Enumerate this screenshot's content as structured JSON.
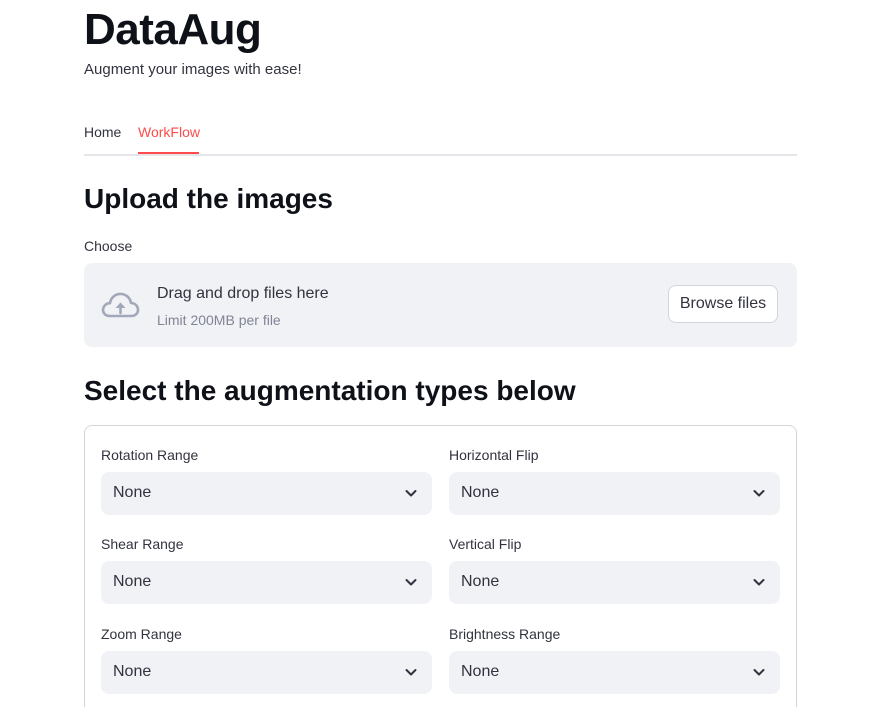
{
  "app": {
    "title": "DataAug",
    "subtitle": "Augment your images with ease!"
  },
  "tabs": [
    {
      "label": "Home",
      "active": false
    },
    {
      "label": "WorkFlow",
      "active": true
    }
  ],
  "upload": {
    "heading": "Upload the images",
    "field_label": "Choose",
    "drop_text": "Drag and drop files here",
    "limit_text": "Limit 200MB per file",
    "browse_label": "Browse files",
    "icon": "cloud-upload-icon"
  },
  "augmentation": {
    "heading": "Select the augmentation types below",
    "fields": [
      {
        "label": "Rotation Range",
        "value": "None"
      },
      {
        "label": "Horizontal Flip",
        "value": "None"
      },
      {
        "label": "Shear Range",
        "value": "None"
      },
      {
        "label": "Vertical Flip",
        "value": "None"
      },
      {
        "label": "Zoom Range",
        "value": "None"
      },
      {
        "label": "Brightness Range",
        "value": "None"
      }
    ]
  },
  "colors": {
    "accent": "#ff4b4b",
    "text": "#31333f",
    "input_bg": "#f0f2f6",
    "muted": "#808495"
  }
}
